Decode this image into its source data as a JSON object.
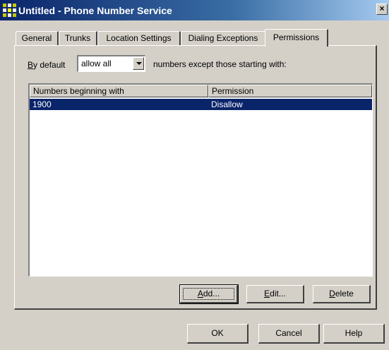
{
  "window": {
    "title": "Untitled - Phone Number Service",
    "close_label": "×",
    "icon": "phone-service-icon"
  },
  "tabs": [
    {
      "label": "General",
      "active": false
    },
    {
      "label": "Trunks",
      "active": false
    },
    {
      "label": "Location Settings",
      "active": false
    },
    {
      "label": "Dialing Exceptions",
      "active": false
    },
    {
      "label": "Permissions",
      "active": true
    }
  ],
  "permissions": {
    "default_label_underlined": "B",
    "default_label_rest": "y default",
    "default_value": "allow all",
    "suffix_text": "numbers except those starting with:",
    "columns": [
      "Numbers beginning with",
      "Permission"
    ],
    "rows": [
      {
        "number": "1900",
        "permission": "Disallow",
        "selected": true
      }
    ]
  },
  "buttons": {
    "add_u": "A",
    "add_rest": "dd...",
    "edit_u": "E",
    "edit_rest": "dit...",
    "delete_u": "D",
    "delete_rest": "elete"
  },
  "footer": {
    "ok": "OK",
    "cancel": "Cancel",
    "help": "Help"
  },
  "colors": {
    "title_bar_start": "#0a246a",
    "selection": "#0a246a",
    "face": "#d4d0c8"
  }
}
